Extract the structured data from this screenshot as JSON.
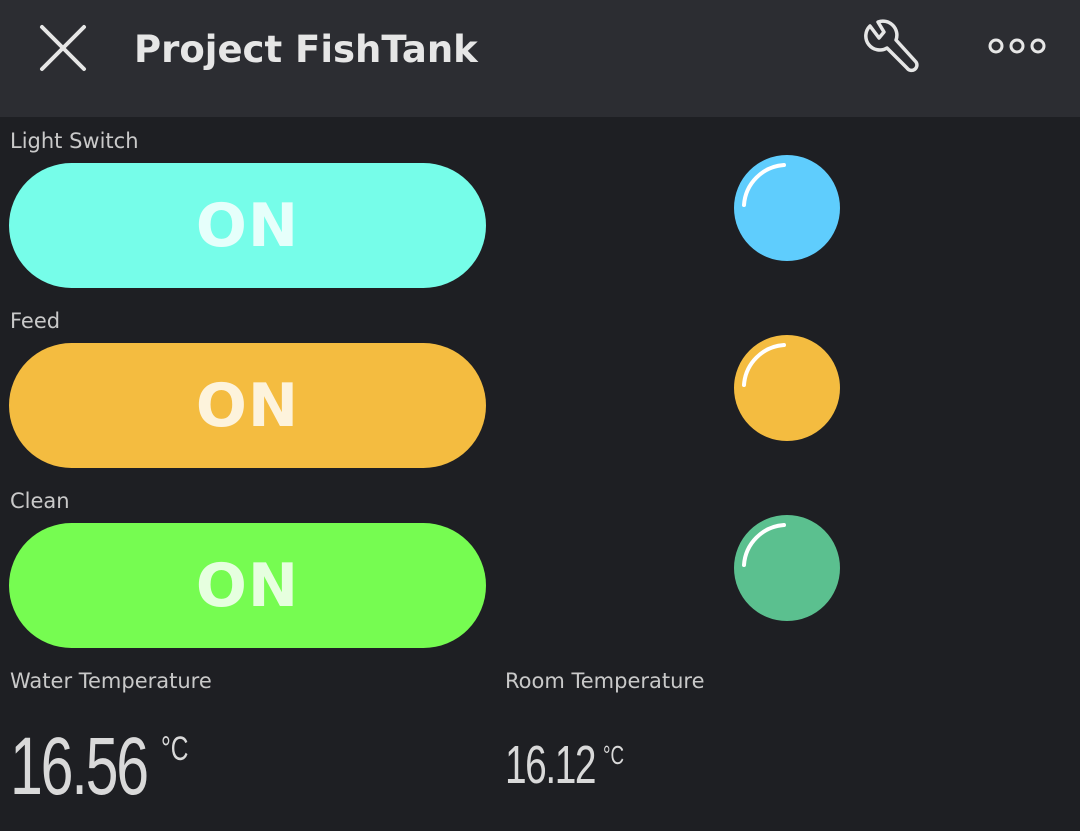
{
  "header": {
    "title": "Project FishTank",
    "close_icon": "close-icon",
    "settings_icon": "wrench-icon",
    "more_icon": "more-dots-icon",
    "background": "#2c2d32"
  },
  "widgets": [
    {
      "label": "Light Switch",
      "state": "ON",
      "color": "#76fde9",
      "led_color": "#5fcdfd"
    },
    {
      "label": "Feed",
      "state": "ON",
      "color": "#f4bc40",
      "led_color": "#f4bc40"
    },
    {
      "label": "Clean",
      "state": "ON",
      "color": "#76fc51",
      "led_color": "#5bc08f"
    }
  ],
  "gauges": {
    "water": {
      "label": "Water Temperature",
      "value": "16.56",
      "unit": "°C"
    },
    "room": {
      "label": "Room Temperature",
      "value": "16.12",
      "unit": "°C"
    }
  }
}
